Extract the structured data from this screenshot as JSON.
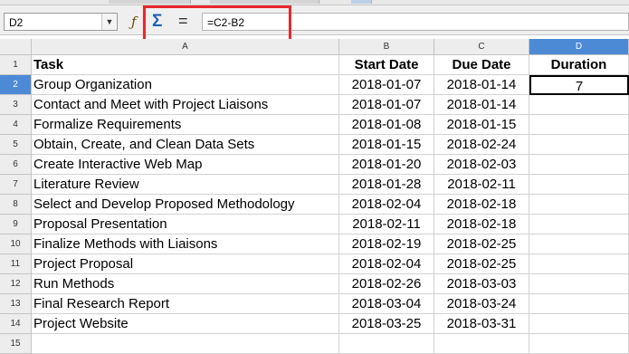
{
  "name_box": {
    "value": "D2"
  },
  "formula": {
    "value": "=C2-B2"
  },
  "columns": [
    "A",
    "B",
    "C",
    "D"
  ],
  "rows": [
    "1",
    "2",
    "3",
    "4",
    "5",
    "6",
    "7",
    "8",
    "9",
    "10",
    "11",
    "12",
    "13",
    "14",
    "15"
  ],
  "headers": {
    "task": "Task",
    "start": "Start Date",
    "due": "Due Date",
    "duration": "Duration"
  },
  "tasks": [
    {
      "task": "Group Organization",
      "start": "2018-01-07",
      "due": "2018-01-14",
      "duration": "7"
    },
    {
      "task": "Contact and Meet with Project Liaisons",
      "start": "2018-01-07",
      "due": "2018-01-14",
      "duration": ""
    },
    {
      "task": "Formalize Requirements",
      "start": "2018-01-08",
      "due": "2018-01-15",
      "duration": ""
    },
    {
      "task": "Obtain, Create, and Clean Data Sets",
      "start": "2018-01-15",
      "due": "2018-02-24",
      "duration": ""
    },
    {
      "task": "Create Interactive Web Map",
      "start": "2018-01-20",
      "due": "2018-02-03",
      "duration": ""
    },
    {
      "task": "Literature Review",
      "start": "2018-01-28",
      "due": "2018-02-11",
      "duration": ""
    },
    {
      "task": "Select and Develop Proposed Methodology",
      "start": "2018-02-04",
      "due": "2018-02-18",
      "duration": ""
    },
    {
      "task": "Proposal Presentation",
      "start": "2018-02-11",
      "due": "2018-02-18",
      "duration": ""
    },
    {
      "task": "Finalize Methods with Liaisons",
      "start": "2018-02-19",
      "due": "2018-02-25",
      "duration": ""
    },
    {
      "task": "Project Proposal",
      "start": "2018-02-04",
      "due": "2018-02-25",
      "duration": ""
    },
    {
      "task": "Run Methods",
      "start": "2018-02-26",
      "due": "2018-03-03",
      "duration": ""
    },
    {
      "task": "Final Research Report",
      "start": "2018-03-04",
      "due": "2018-03-24",
      "duration": ""
    },
    {
      "task": "Project Website",
      "start": "2018-03-25",
      "due": "2018-03-31",
      "duration": ""
    }
  ],
  "colors": {
    "highlight": "#e8272c",
    "active_header": "#4d8ad6",
    "sigma": "#1f5fb4"
  },
  "icons": {
    "function_wizard": "fx-icon",
    "sum": "sigma-icon",
    "formula": "equals-icon",
    "dropdown": "chevron-down-icon"
  }
}
